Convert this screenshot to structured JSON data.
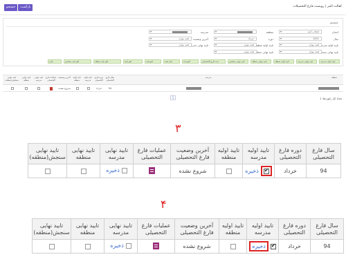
{
  "topbar": {
    "breadcrumb": "کفالت المر | رویصت فارغ التحصیلات",
    "btn_save": "جستجو",
    "btn_back": "بازگشت"
  },
  "filter_panel": {
    "tab_label": "جستجو",
    "fields": [
      {
        "label": "استان",
        "value": "انتخاب کنید"
      },
      {
        "label": "سال",
        "value": "1401"
      },
      {
        "label": "تایید اولیه مدرسه",
        "value": "همه موارد"
      },
      {
        "label": "تایید نهایی سنجش",
        "value": "همه موارد"
      },
      {
        "label": "منطقه",
        "value": ""
      },
      {
        "label": "دوره",
        "value": "خرداد"
      },
      {
        "label": "تایید اولیه منطقه",
        "value": "همه موارد"
      },
      {
        "label": "تایید نهایی منطقه",
        "value": "همه موارد"
      },
      {
        "label": "مدرسه",
        "value": ""
      },
      {
        "label": "آخرین وضعیت",
        "value": "همه موارد"
      },
      {
        "label": "تایید نهایی مدرسه",
        "value": "همه موارد"
      }
    ],
    "green_buttons": [
      "تایید اولیه مدرسه",
      "تایید نهایی مدرسه",
      "تایید اولیه منطقه",
      "تایید نهایی منطقه",
      "تایید نهایی سنجش",
      "ثبت فارغ التحصیلی",
      "لغو ثبت",
      "تایید همه",
      "لغو همه",
      "لغو تایید",
      "لغو تایید منطقه",
      "لغو تایید سنجش",
      "چاپ"
    ]
  },
  "small_table": {
    "headers": [
      "منطقه",
      "مدرسه",
      "سال فارغ التحصیلی",
      "دوره فارغ التحصیلی",
      "تایید اولیه مدرسه",
      "تایید اولیه منطقه",
      "آخرین وضعیت",
      "عملیات فارغ التحصیلی",
      "تایید نهایی مدرسه",
      "تایید نهایی منطقه",
      "تایید نهایی سنجش(منطقه)"
    ],
    "row": {
      "year": "94",
      "term": "خرداد",
      "status": "شروع نشده"
    },
    "pager": "1",
    "count": "تعداد کل رکوردها: 1"
  },
  "section3": {
    "number": "۳",
    "headers": [
      "سال فارغ التحصیلی",
      "دوره فارغ التحصیلی",
      "تایید اولیه مدرسه",
      "تایید اولیه منطقه",
      "آخرین وضعیت فارغ التحصیلی",
      "عملیات فارغ التحصیلی",
      "تایید نهایی مدرسه",
      "تایید نهایی منطقه",
      "تایید نهایی سنجش(منطقه)"
    ],
    "row": {
      "year": "94",
      "term": "خرداد",
      "save": "ذخیره",
      "status": "شروع نشده",
      "save2": "ذخیره"
    }
  },
  "section4": {
    "number": "۴",
    "headers": [
      "سال فارغ التحصیلی",
      "دوره فارغ التحصیلی",
      "تایید اولیه مدرسه",
      "تایید اولیه منطقه",
      "آخرین وضعیت فارغ التحصیلی",
      "عملیات فارغ التحصیلی",
      "تایید نهایی مدرسه",
      "تایید نهایی منطقه",
      "تایید نهایی سنجش(منطقه)"
    ],
    "row": {
      "year": "94",
      "term": "خرداد",
      "save": "ذخیره",
      "status": "شروع نشده",
      "save2": "ذخیره"
    }
  },
  "colors": {
    "accent": "#6b58c6",
    "highlight": "#dd2222",
    "green": "#e0eecd",
    "link": "#3366cc"
  }
}
